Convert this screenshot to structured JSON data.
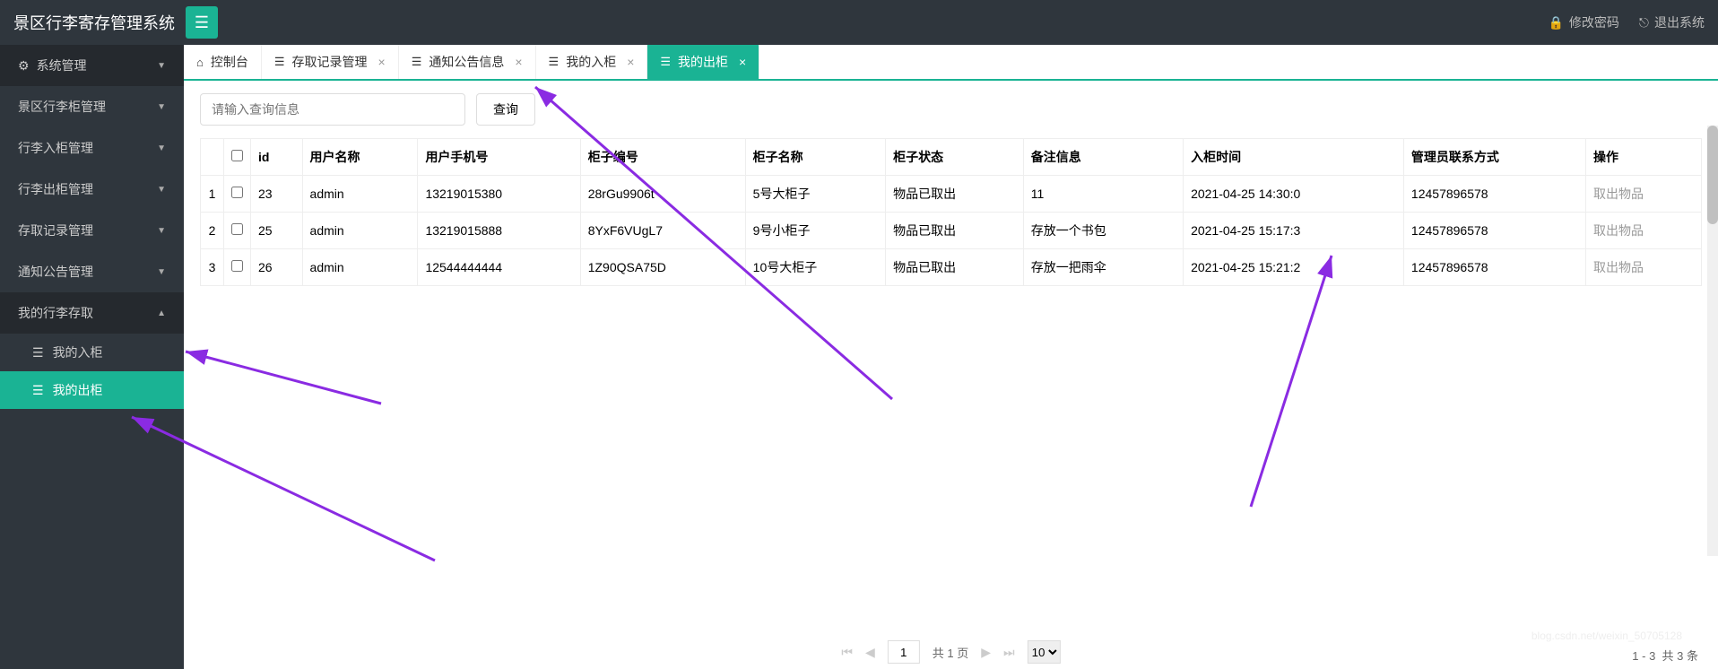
{
  "header": {
    "title": "景区行李寄存管理系统",
    "change_pwd": "修改密码",
    "logout": "退出系统"
  },
  "sidebar": {
    "items": [
      {
        "label": "系统管理",
        "icon": "gear",
        "chev": "down",
        "dark": true
      },
      {
        "label": "景区行李柜管理",
        "chev": "down"
      },
      {
        "label": "行李入柜管理",
        "chev": "down"
      },
      {
        "label": "行李出柜管理",
        "chev": "down"
      },
      {
        "label": "存取记录管理",
        "chev": "down"
      },
      {
        "label": "通知公告管理",
        "chev": "down"
      },
      {
        "label": "我的行李存取",
        "chev": "up",
        "dark": true
      }
    ],
    "subs": [
      {
        "label": "我的入柜",
        "active": false
      },
      {
        "label": "我的出柜",
        "active": true
      }
    ]
  },
  "tabs": [
    {
      "icon": "home",
      "label": "控制台",
      "closable": false
    },
    {
      "icon": "list",
      "label": "存取记录管理",
      "closable": true
    },
    {
      "icon": "list",
      "label": "通知公告信息",
      "closable": true
    },
    {
      "icon": "list",
      "label": "我的入柜",
      "closable": true
    },
    {
      "icon": "list",
      "label": "我的出柜",
      "closable": true,
      "active": true
    }
  ],
  "toolbar": {
    "search_placeholder": "请输入查询信息",
    "search_value": "",
    "query_label": "查询"
  },
  "table": {
    "headers": [
      "",
      "",
      "id",
      "用户名称",
      "用户手机号",
      "柜子编号",
      "柜子名称",
      "柜子状态",
      "备注信息",
      "入柜时间",
      "管理员联系方式",
      "操作"
    ],
    "op_label": "取出物品",
    "rows": [
      {
        "n": "1",
        "id": "23",
        "user": "admin",
        "phone": "13219015380",
        "code": "28rGu9906t",
        "cab": "5号大柜子",
        "status": "物品已取出",
        "remark": "11",
        "time": "2021-04-25 14:30:0",
        "mgr": "12457896578"
      },
      {
        "n": "2",
        "id": "25",
        "user": "admin",
        "phone": "13219015888",
        "code": "8YxF6VUgL7",
        "cab": "9号小柜子",
        "status": "物品已取出",
        "remark": "存放一个书包",
        "time": "2021-04-25 15:17:3",
        "mgr": "12457896578"
      },
      {
        "n": "3",
        "id": "26",
        "user": "admin",
        "phone": "12544444444",
        "code": "1Z90QSA75D",
        "cab": "10号大柜子",
        "status": "物品已取出",
        "remark": "存放一把雨伞",
        "time": "2021-04-25 15:21:2",
        "mgr": "12457896578"
      }
    ]
  },
  "pager": {
    "page": "1",
    "total_pages_label": "共 1 页",
    "page_size": "10",
    "summary_prefix": "1 - 3",
    "summary_suffix": "共 3 条"
  }
}
